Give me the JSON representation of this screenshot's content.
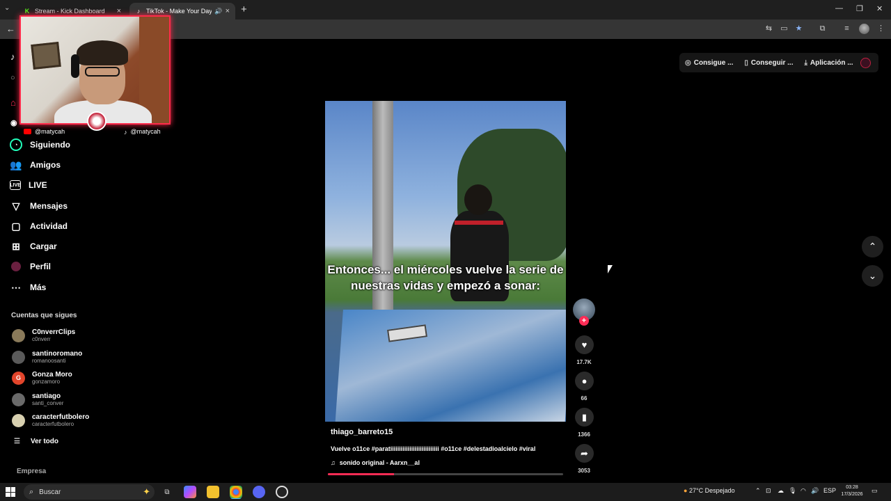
{
  "browser": {
    "tabs": [
      {
        "title": "Stream - Kick Dashboard",
        "favicon": "kick-icon"
      },
      {
        "title": "TikTok - Make Your Day",
        "favicon": "tiktok-icon",
        "active": true
      }
    ]
  },
  "topbar": {
    "btn_coins": "Consigue ...",
    "btn_get": "Conseguir ...",
    "btn_app": "Aplicación ..."
  },
  "overlay": {
    "youtube_handle": "@matycah",
    "tiktok_handle": "@matycah"
  },
  "sidebar": {
    "items": [
      {
        "label": "Siguiendo",
        "icon": "following-icon"
      },
      {
        "label": "Amigos",
        "icon": "friends-icon"
      },
      {
        "label": "LIVE",
        "icon": "live-icon"
      },
      {
        "label": "Mensajes",
        "icon": "messages-icon"
      },
      {
        "label": "Actividad",
        "icon": "activity-icon"
      },
      {
        "label": "Cargar",
        "icon": "upload-icon"
      },
      {
        "label": "Perfil",
        "icon": "profile-icon"
      },
      {
        "label": "Más",
        "icon": "more-icon"
      }
    ],
    "following_header": "Cuentas que sigues",
    "accounts": [
      {
        "name": "C0nverrClips",
        "handle": "c0nverr",
        "color": "#8a7a5a"
      },
      {
        "name": "santinoromano",
        "handle": "romanoosanti",
        "color": "#5a5a5a"
      },
      {
        "name": "Gonza Moro",
        "handle": "gonzamoro",
        "color": "#e2452b",
        "initial": "G"
      },
      {
        "name": "santiago",
        "handle": "santi_conver",
        "color": "#6a6a6a"
      },
      {
        "name": "caracterfutbolero",
        "handle": "caracterfutbolero",
        "color": "#d8d0b0"
      }
    ],
    "see_all": "Ver todo",
    "footer": "Empresa"
  },
  "video": {
    "overlay_text": "Entonces... el miércoles vuelve la serie de nuestras vidas y empezó a sonar:",
    "author": "thiago_barreto15",
    "description": "Vuelve o11ce #paratiiiiiiiiiiiiiiiiiiiiiiiiiiii #o11ce #delestadioalcielo #viral",
    "sound": "sonido original - Aarxn__al",
    "progress": 0.28
  },
  "actions": {
    "likes": "17.7K",
    "comments": "66",
    "saves": "1366",
    "shares": "3053"
  },
  "taskbar": {
    "search_placeholder": "Buscar",
    "weather": "27°C  Despejado",
    "lang": "ESP",
    "time": "03:28",
    "date": "17/3/2026"
  }
}
